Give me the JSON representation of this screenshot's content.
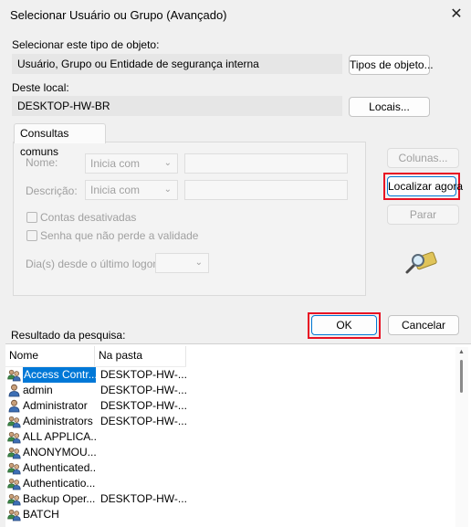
{
  "window": {
    "title": "Selecionar Usuário ou Grupo (Avançado)",
    "close_glyph": "✕"
  },
  "object_type": {
    "label": "Selecionar este tipo de objeto:",
    "value": "Usuário, Grupo ou Entidade de segurança interna",
    "button": "Tipos de objeto..."
  },
  "location": {
    "label": "Deste local:",
    "value": "DESKTOP-HW-BR",
    "button": "Locais..."
  },
  "common_queries": {
    "tab": "Consultas comuns",
    "name_label": "Nome:",
    "name_mode": "Inicia com",
    "description_label": "Descrição:",
    "description_mode": "Inicia com",
    "disabled_accounts": "Contas desativadas",
    "non_expiring_password": "Senha que não perde a validade",
    "days_since_logon": "Dia(s) desde o último logon:"
  },
  "side_buttons": {
    "columns": "Colunas...",
    "find_now": "Localizar agora",
    "stop": "Parar"
  },
  "ok": "OK",
  "cancel": "Cancelar",
  "results": {
    "label": "Resultado da pesquisa:",
    "columns": [
      "Nome",
      "Na pasta"
    ],
    "rows": [
      {
        "name": "Access Contr...",
        "folder": "DESKTOP-HW-...",
        "icon": "group-icon",
        "selected": true
      },
      {
        "name": "admin",
        "folder": "DESKTOP-HW-...",
        "icon": "user-icon"
      },
      {
        "name": "Administrator",
        "folder": "DESKTOP-HW-...",
        "icon": "user-icon"
      },
      {
        "name": "Administrators",
        "folder": "DESKTOP-HW-...",
        "icon": "group-icon"
      },
      {
        "name": "ALL APPLICA...",
        "folder": "",
        "icon": "group-icon"
      },
      {
        "name": "ANONYMOU...",
        "folder": "",
        "icon": "group-icon"
      },
      {
        "name": "Authenticated...",
        "folder": "",
        "icon": "group-icon"
      },
      {
        "name": "Authenticatio...",
        "folder": "",
        "icon": "group-icon"
      },
      {
        "name": "Backup Oper...",
        "folder": "DESKTOP-HW-...",
        "icon": "group-icon"
      },
      {
        "name": "BATCH",
        "folder": "",
        "icon": "group-icon"
      }
    ]
  },
  "colors": {
    "highlight": "#e81123",
    "selection": "#0078d7",
    "accent": "#0078d4"
  }
}
